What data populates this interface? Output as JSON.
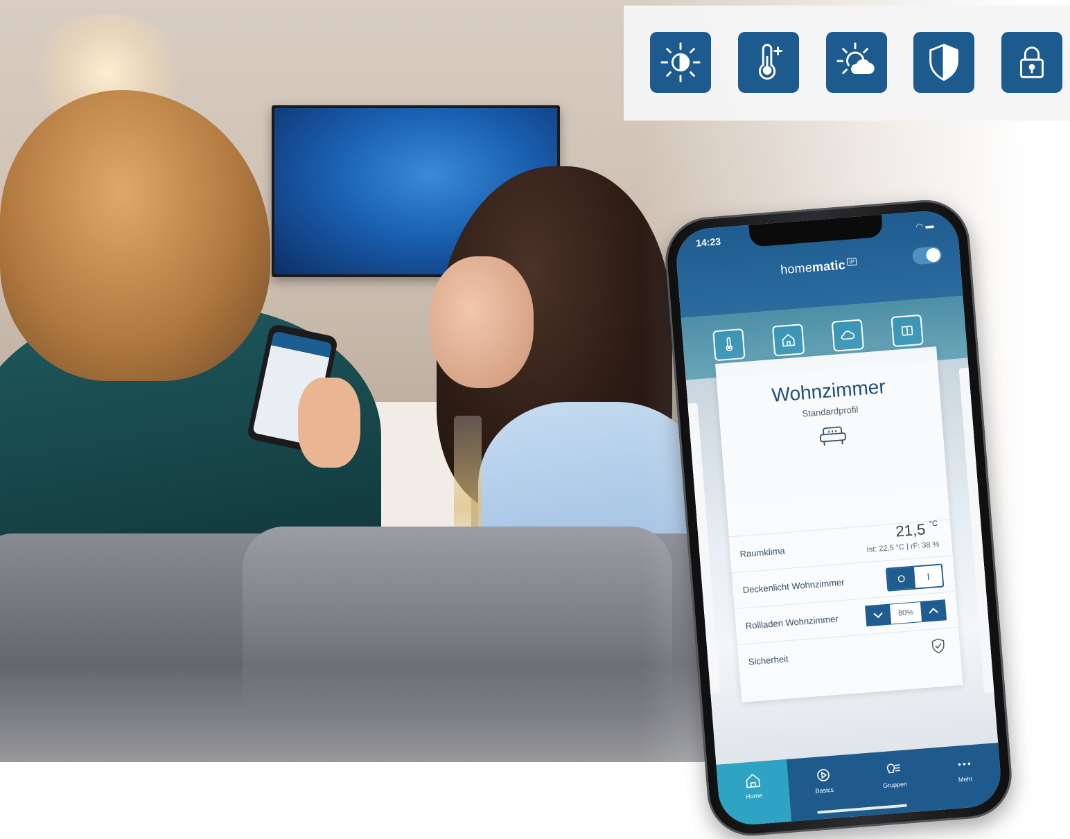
{
  "feature_icons": [
    {
      "icon": "light-brightness-icon"
    },
    {
      "icon": "thermometer-icon"
    },
    {
      "icon": "weather-sun-cloud-icon"
    },
    {
      "icon": "security-shield-icon"
    },
    {
      "icon": "padlock-icon"
    }
  ],
  "colors": {
    "brand_blue": "#1d5a8d",
    "accent_teal": "#2ea3c4"
  },
  "phone": {
    "status": {
      "time": "14:23"
    },
    "brand": {
      "prefix": "home",
      "bold": "matic",
      "badge": "IP"
    },
    "quick_actions": [
      {
        "icon": "thermometer-icon"
      },
      {
        "icon": "house-icon"
      },
      {
        "icon": "cloud-icon"
      },
      {
        "icon": "window-icon"
      }
    ],
    "room": {
      "title": "Wohnzimmer",
      "subtitle": "Standardprofil",
      "icon": "sofa-icon"
    },
    "devices": {
      "climate": {
        "label": "Raumklima",
        "temperature": "21,5",
        "unit": "°C",
        "detail": "Ist: 22,5 °C | rF: 38 %"
      },
      "light": {
        "label": "Deckenlicht Wohnzimmer",
        "off_label": "O",
        "on_label": "I",
        "state": "off"
      },
      "blinds": {
        "label": "Rollladen Wohnzimmer",
        "value": "80%"
      },
      "security": {
        "label": "Sicherheit",
        "icon": "shield-check-icon"
      }
    },
    "nav": [
      {
        "label": "Home",
        "icon": "home-icon",
        "active": true
      },
      {
        "label": "Basics",
        "icon": "gear-play-icon",
        "active": false
      },
      {
        "label": "Gruppen",
        "icon": "lightbulb-list-icon",
        "active": false
      },
      {
        "label": "Mehr",
        "icon": "more-dots-icon",
        "active": false
      }
    ]
  }
}
